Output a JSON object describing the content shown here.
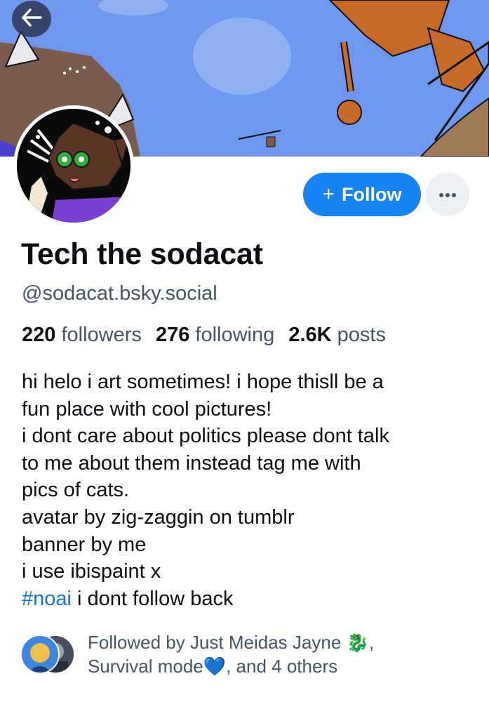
{
  "profile": {
    "display_name": "Tech the sodacat",
    "handle": "@sodacat.bsky.social"
  },
  "actions": {
    "follow_plus": "+",
    "follow_label": "Follow",
    "more_label": "···"
  },
  "stats": {
    "followers_count": "220",
    "followers_label": "followers",
    "following_count": "276",
    "following_label": "following",
    "posts_count": "2.6K",
    "posts_label": "posts"
  },
  "bio": {
    "lines": [
      "hi helo i art sometimes! i hope thisll be a",
      "fun place with cool pictures!",
      "i dont care about politics please dont talk",
      "to me about them instead tag me with",
      "pics of cats.",
      "avatar by zig-zaggin on tumblr",
      "banner by me",
      "i use ibispaint x"
    ],
    "hashtag": "#noai",
    "last_line_rest": " i dont follow back"
  },
  "followed_by": {
    "line1": "Followed by Just Meidas Jayne 🐉,",
    "line2": "Survival mode💙, and 4 others"
  },
  "colors": {
    "accent": "#1683f4",
    "link": "#1570e0",
    "muted": "#44546a",
    "banner_sky": "#6f97ee"
  },
  "icons": {
    "back": "arrow-left-icon",
    "more": "ellipsis-icon"
  }
}
